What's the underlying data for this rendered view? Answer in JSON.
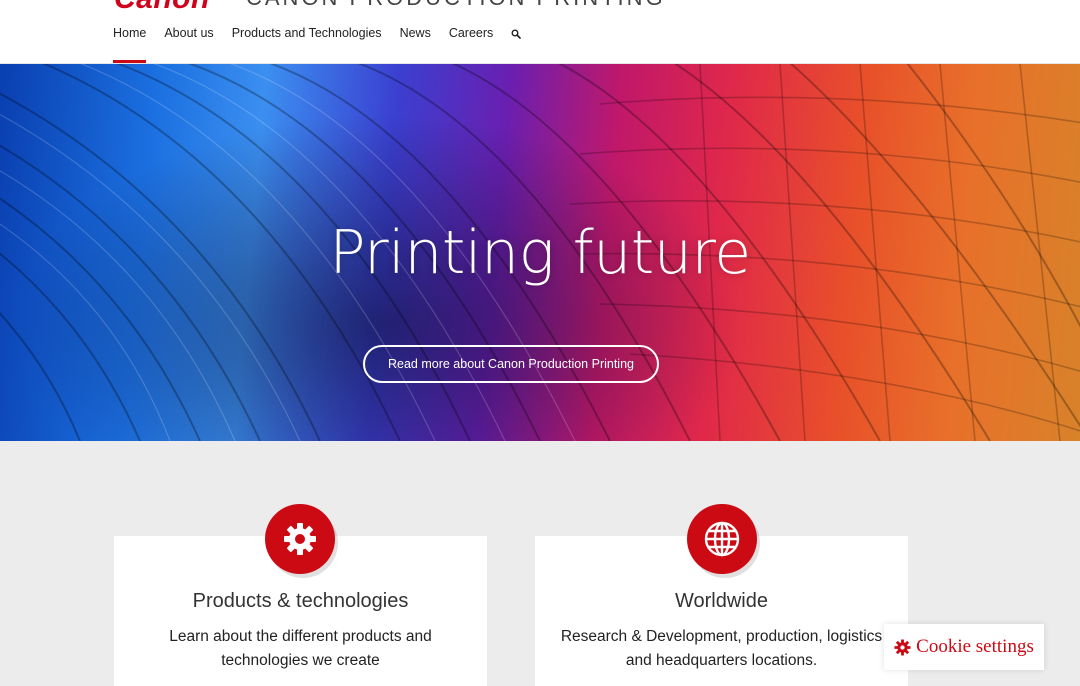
{
  "brand": {
    "logo": "Canon",
    "tagline": "CANON PRODUCTION PRINTING"
  },
  "nav": {
    "items": [
      {
        "label": "Home",
        "active": true
      },
      {
        "label": "About us"
      },
      {
        "label": "Products and Technologies"
      },
      {
        "label": "News"
      },
      {
        "label": "Careers"
      }
    ],
    "search_icon": "search-icon"
  },
  "hero": {
    "title": "Printing future",
    "button_label": "Read more about Canon Production Printing"
  },
  "cards": [
    {
      "icon": "gear-icon",
      "title": "Products & technologies",
      "text": "Learn about the different products and technologies we create"
    },
    {
      "icon": "globe-icon",
      "title": "Worldwide",
      "text": "Research & Development, production, logistics and headquarters locations."
    }
  ],
  "cookie": {
    "label": "Cookie settings",
    "icon": "gear-icon"
  },
  "colors": {
    "brand_red": "#cc0a14",
    "background": "#ececec"
  }
}
